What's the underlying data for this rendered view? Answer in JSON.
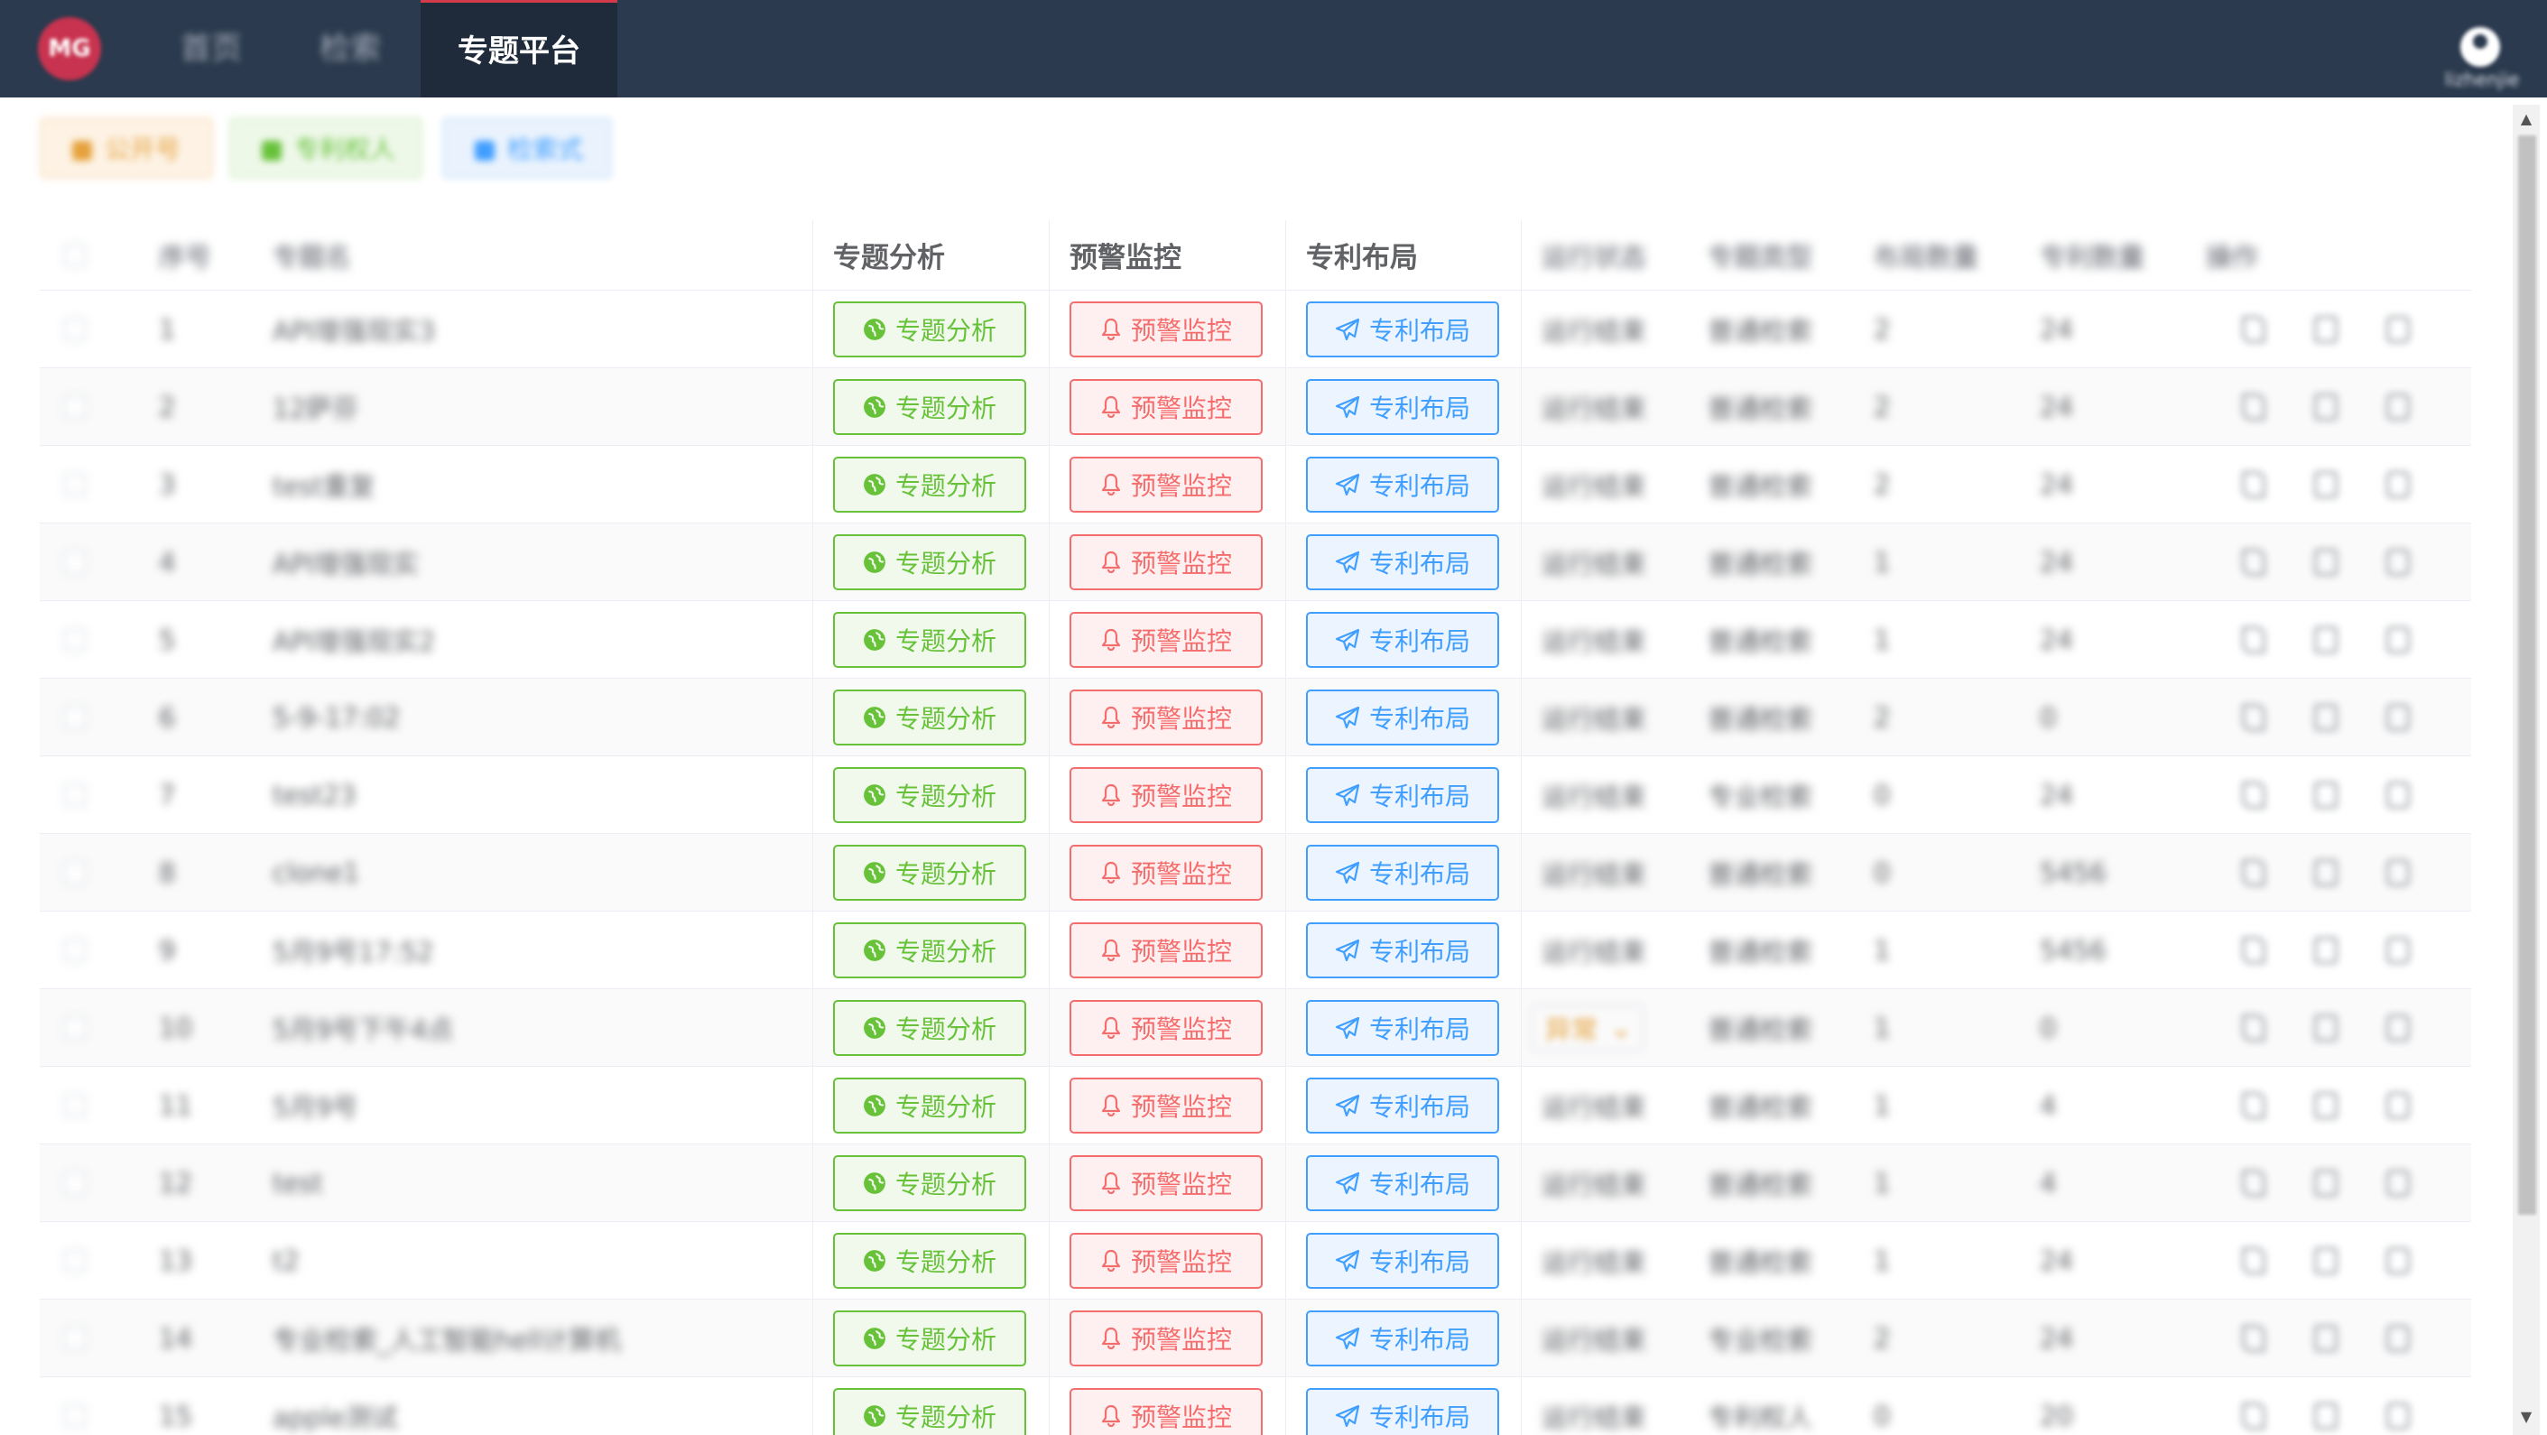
{
  "nav": {
    "logo": "MG",
    "items": [
      {
        "label": "首页"
      },
      {
        "label": "检索"
      },
      {
        "label": "专题平台"
      }
    ],
    "user_name": "lizhenjie"
  },
  "toolbar": {
    "chips": [
      {
        "label": "公开号",
        "color": "#e6a23c"
      },
      {
        "label": "专利权人",
        "color": "#67c23a"
      },
      {
        "label": "检索式",
        "color": "#409eff"
      }
    ]
  },
  "table": {
    "headers": {
      "index": "序号",
      "name": "专题名",
      "analysis": "专题分析",
      "warning": "预警监控",
      "layout": "专利布局",
      "status": "运行状态",
      "type": "专题类型",
      "layout_count": "布局数量",
      "patent_count": "专利数量",
      "actions": "操作"
    },
    "button_labels": {
      "analysis": "专题分析",
      "warning": "预警监控",
      "layout": "专利布局"
    },
    "rows": [
      {
        "index": "1",
        "name": "API增强现实3",
        "status": "运行结束",
        "type": "普通检索",
        "layout_count": "2",
        "patent_count": "24"
      },
      {
        "index": "2",
        "name": "12萨芬",
        "status": "运行结束",
        "type": "普通检索",
        "layout_count": "2",
        "patent_count": "24"
      },
      {
        "index": "3",
        "name": "test重复",
        "status": "运行结束",
        "type": "普通检索",
        "layout_count": "2",
        "patent_count": "24"
      },
      {
        "index": "4",
        "name": "API增强现实",
        "status": "运行结束",
        "type": "普通检索",
        "layout_count": "1",
        "patent_count": "24"
      },
      {
        "index": "5",
        "name": "API增强现实2",
        "status": "运行结束",
        "type": "普通检索",
        "layout_count": "1",
        "patent_count": "24"
      },
      {
        "index": "6",
        "name": "5-9-17:02",
        "status": "运行结束",
        "type": "普通检索",
        "layout_count": "2",
        "patent_count": "0"
      },
      {
        "index": "7",
        "name": "test23",
        "status": "运行结束",
        "type": "专业检索",
        "layout_count": "0",
        "patent_count": "24"
      },
      {
        "index": "8",
        "name": "clone1",
        "status": "运行结束",
        "type": "普通检索",
        "layout_count": "0",
        "patent_count": "5456"
      },
      {
        "index": "9",
        "name": "5月9号17:52",
        "status": "运行结束",
        "type": "普通检索",
        "layout_count": "1",
        "patent_count": "5456"
      },
      {
        "index": "10",
        "name": "5月9号下午4点",
        "status": "异常",
        "type": "普通检索",
        "layout_count": "1",
        "patent_count": "0"
      },
      {
        "index": "11",
        "name": "5月9号",
        "status": "运行结束",
        "type": "普通检索",
        "layout_count": "1",
        "patent_count": "4"
      },
      {
        "index": "12",
        "name": "test",
        "status": "运行结束",
        "type": "普通检索",
        "layout_count": "1",
        "patent_count": "4"
      },
      {
        "index": "13",
        "name": "t2",
        "status": "运行结束",
        "type": "普通检索",
        "layout_count": "1",
        "patent_count": "24"
      },
      {
        "index": "14",
        "name": "专业检索_人工智能hell计算机",
        "status": "运行结束",
        "type": "专业检索",
        "layout_count": "2",
        "patent_count": "24"
      },
      {
        "index": "15",
        "name": "apple测试",
        "status": "运行结束",
        "type": "专利权人",
        "layout_count": "0",
        "patent_count": "20"
      }
    ]
  }
}
